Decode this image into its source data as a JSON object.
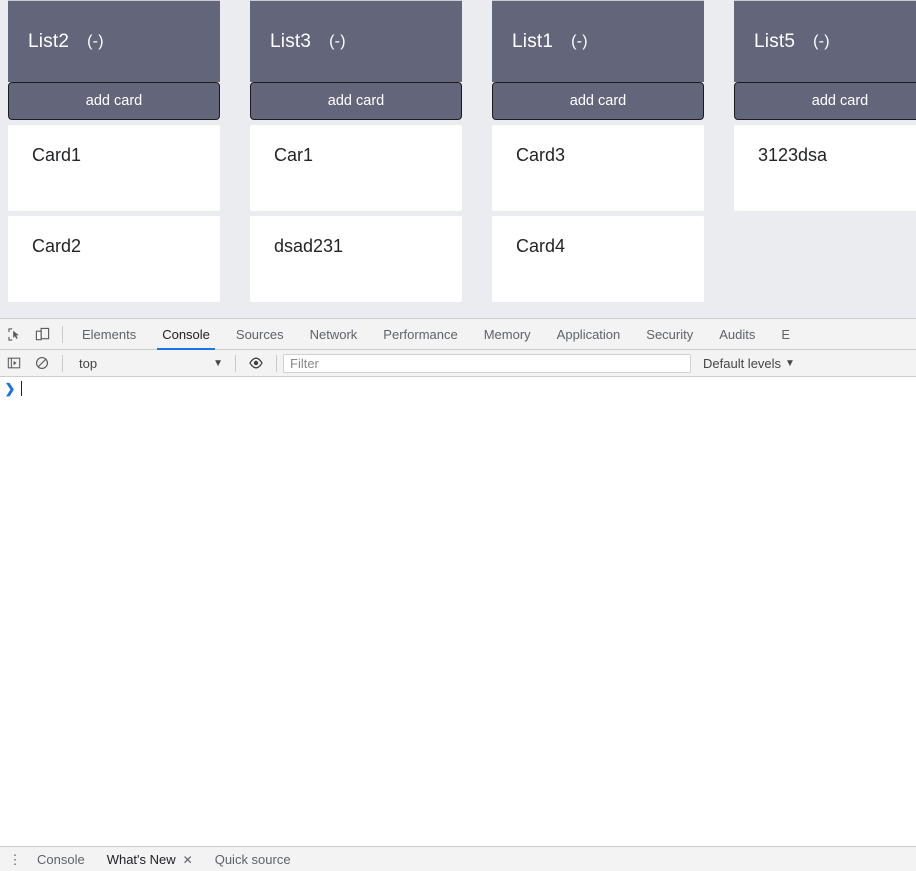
{
  "board": {
    "lists": [
      {
        "name": "List2",
        "count": "(-)",
        "add_card_label": "add card",
        "cards": [
          {
            "title": "Card1"
          },
          {
            "title": "Card2"
          }
        ]
      },
      {
        "name": "List3",
        "count": "(-)",
        "add_card_label": "add card",
        "cards": [
          {
            "title": "Car1"
          },
          {
            "title": "dsad231"
          }
        ]
      },
      {
        "name": "List1",
        "count": "(-)",
        "add_card_label": "add card",
        "cards": [
          {
            "title": "Card3"
          },
          {
            "title": "Card4"
          }
        ]
      },
      {
        "name": "List5",
        "count": "(-)",
        "add_card_label": "add card",
        "cards": [
          {
            "title": "3123dsa"
          }
        ]
      }
    ]
  },
  "devtools": {
    "icons": {
      "inspect": "inspect-element-icon",
      "device": "device-toolbar-icon",
      "sidebar": "console-sidebar-icon",
      "clear": "clear-console-icon",
      "eye": "live-expression-eye-icon"
    },
    "tabs": [
      {
        "label": "Elements",
        "active": false
      },
      {
        "label": "Console",
        "active": true
      },
      {
        "label": "Sources",
        "active": false
      },
      {
        "label": "Network",
        "active": false
      },
      {
        "label": "Performance",
        "active": false
      },
      {
        "label": "Memory",
        "active": false
      },
      {
        "label": "Application",
        "active": false
      },
      {
        "label": "Security",
        "active": false
      },
      {
        "label": "Audits",
        "active": false
      },
      {
        "label": "E",
        "active": false
      }
    ],
    "filterbar": {
      "context_value": "top",
      "context_caret": "▼",
      "filter_placeholder": "Filter",
      "filter_value": "",
      "levels_label": "Default levels",
      "levels_caret": "▼"
    },
    "console": {
      "prompt_symbol": "❯",
      "input_value": ""
    },
    "drawer": {
      "menu_icon": "⋮",
      "tabs": [
        {
          "label": "Console",
          "active": false,
          "closable": false
        },
        {
          "label": "What's New",
          "active": true,
          "closable": true
        },
        {
          "label": "Quick source",
          "active": false,
          "closable": false
        }
      ],
      "close_glyph": "✕"
    }
  },
  "colors": {
    "list_header_bg": "#63667a",
    "board_bg": "#ebecf0",
    "card_bg": "#ffffff",
    "accent_blue": "#1a73e8",
    "devtools_chrome": "#f3f3f3"
  }
}
